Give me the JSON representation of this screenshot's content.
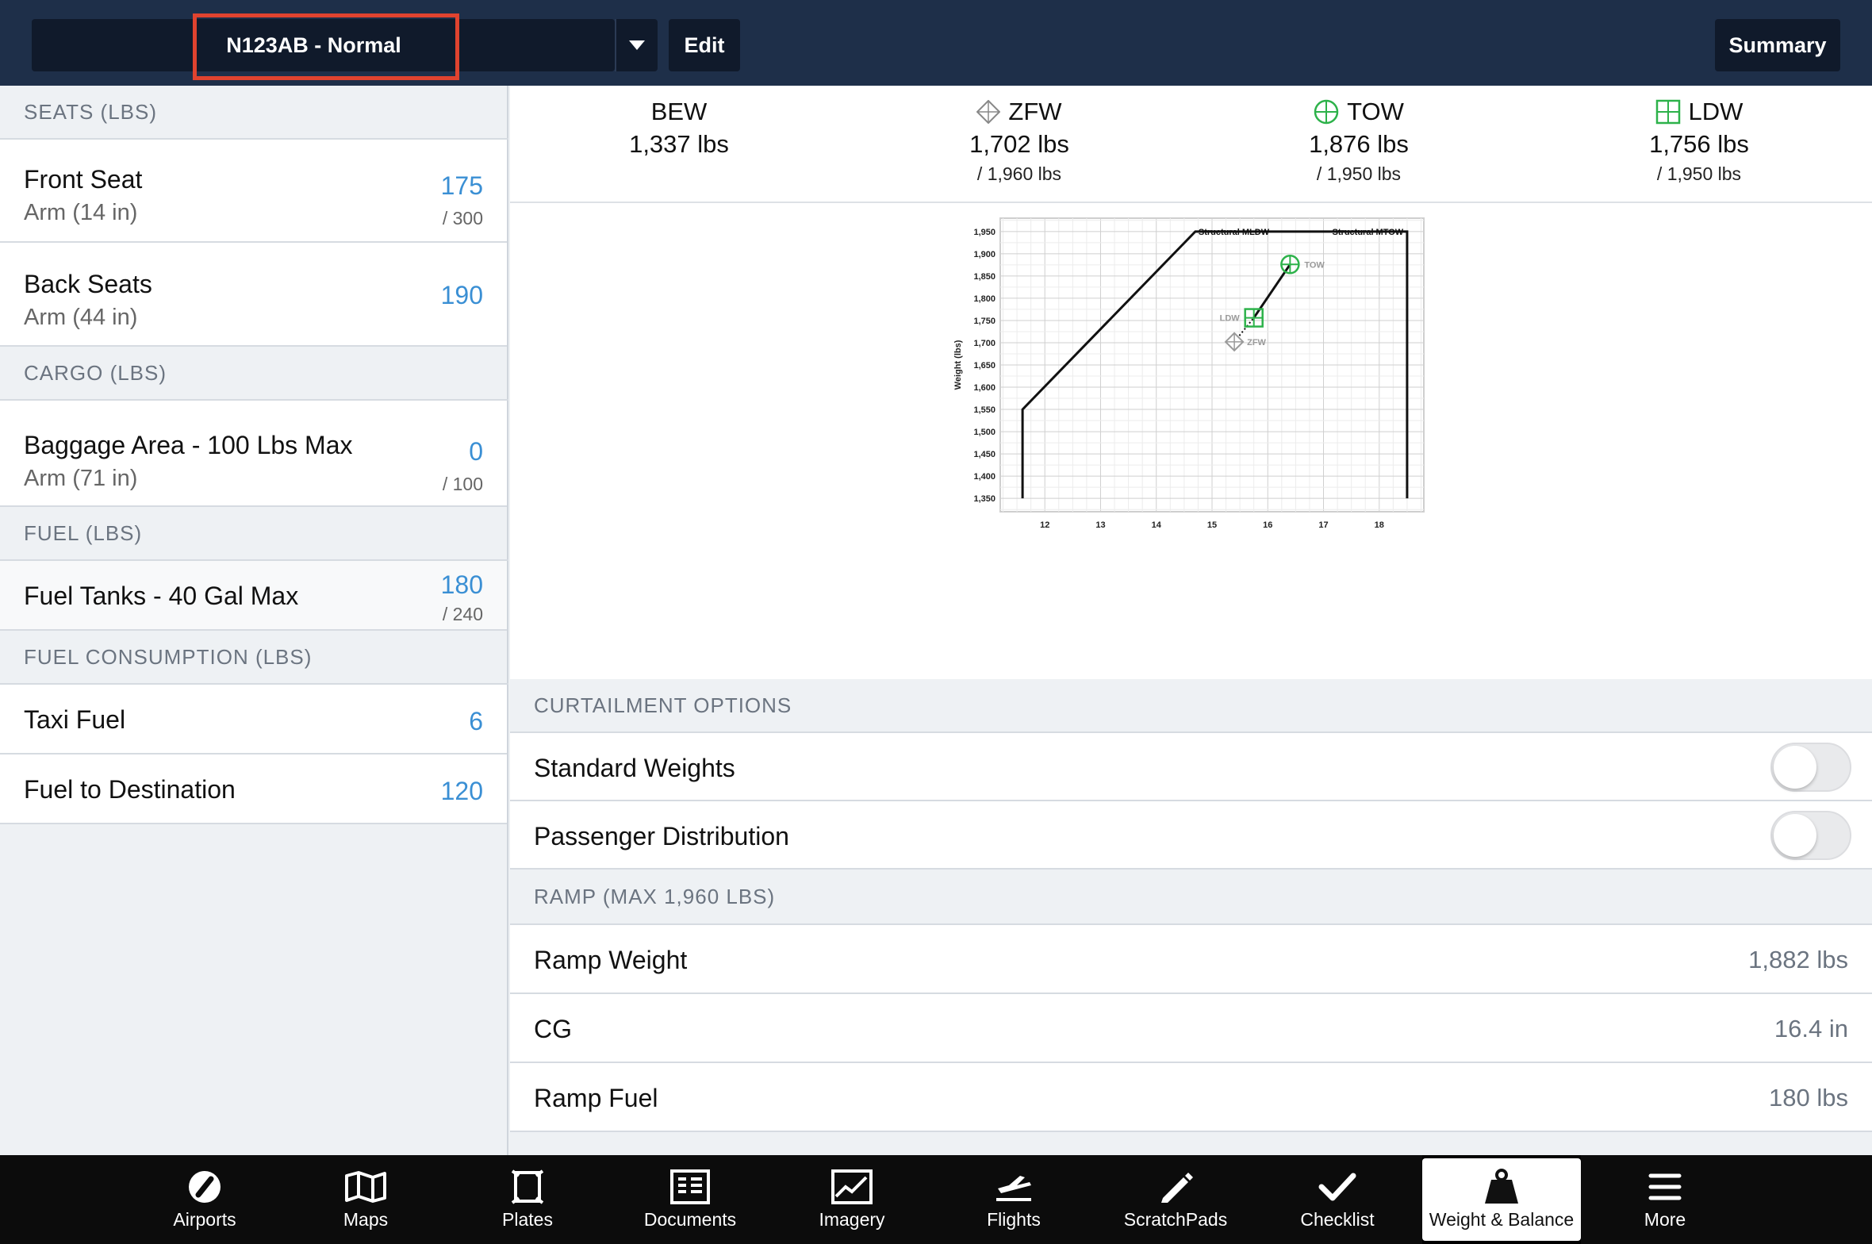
{
  "header": {
    "profile_label": "N123AB - Normal",
    "edit_label": "Edit",
    "summary_label": "Summary"
  },
  "left": {
    "sections": {
      "seats": "SEATS (LBS)",
      "cargo": "CARGO (LBS)",
      "fuel": "FUEL (LBS)",
      "consumption": "FUEL CONSUMPTION (LBS)"
    },
    "front_seat": {
      "title": "Front Seat",
      "arm": "Arm (14 in)",
      "value": "175",
      "max": "/ 300"
    },
    "back_seats": {
      "title": "Back Seats",
      "arm": "Arm (44 in)",
      "value": "190"
    },
    "baggage": {
      "title": "Baggage Area - 100 Lbs Max",
      "arm": "Arm (71 in)",
      "value": "0",
      "max": "/ 100"
    },
    "fuel_tanks": {
      "title": "Fuel Tanks - 40 Gal Max",
      "value": "180",
      "max": "/ 240"
    },
    "taxi_fuel": {
      "title": "Taxi Fuel",
      "value": "6"
    },
    "fuel_to_dest": {
      "title": "Fuel to Destination",
      "value": "120"
    }
  },
  "stats": {
    "bew": {
      "label": "BEW",
      "value": "1,337 lbs"
    },
    "zfw": {
      "label": "ZFW",
      "value": "1,702 lbs",
      "max": "/ 1,960 lbs"
    },
    "tow": {
      "label": "TOW",
      "value": "1,876 lbs",
      "max": "/ 1,950 lbs"
    },
    "ldw": {
      "label": "LDW",
      "value": "1,756 lbs",
      "max": "/ 1,950 lbs"
    }
  },
  "chart_data": {
    "type": "scatter",
    "title": "",
    "xlabel": "",
    "ylabel": "Weight (lbs)",
    "xlim": [
      11.2,
      18.8
    ],
    "ylim": [
      1320,
      1980
    ],
    "x_ticks": [
      12,
      13,
      14,
      15,
      16,
      17,
      18
    ],
    "y_ticks": [
      1350,
      1400,
      1450,
      1500,
      1550,
      1600,
      1650,
      1700,
      1750,
      1800,
      1850,
      1900,
      1950
    ],
    "envelope": [
      [
        11.6,
        1350
      ],
      [
        11.6,
        1550
      ],
      [
        14.7,
        1950
      ],
      [
        18.5,
        1950
      ],
      [
        18.5,
        1350
      ]
    ],
    "annotations": [
      "Structural MLDW",
      "Structural MTOW"
    ],
    "points": [
      {
        "name": "ZFW",
        "x": 15.4,
        "y": 1702,
        "symbol": "diamond",
        "color": "#9a9a9a"
      },
      {
        "name": "LDW",
        "x": 15.75,
        "y": 1756,
        "symbol": "square-cross",
        "color": "#2db24a"
      },
      {
        "name": "TOW",
        "x": 16.4,
        "y": 1876,
        "symbol": "circle-cross",
        "color": "#2db24a"
      }
    ],
    "grid": true
  },
  "curtailment": {
    "header": "CURTAILMENT OPTIONS",
    "standard_weights": "Standard Weights",
    "passenger_distribution": "Passenger Distribution"
  },
  "ramp": {
    "header": "RAMP (MAX 1,960 LBS)",
    "weight_label": "Ramp Weight",
    "weight_value": "1,882 lbs",
    "cg_label": "CG",
    "cg_value": "16.4 in",
    "fuel_label": "Ramp Fuel",
    "fuel_value": "180 lbs"
  },
  "tabs": [
    {
      "label": "Airports",
      "icon": "airports-icon"
    },
    {
      "label": "Maps",
      "icon": "maps-icon"
    },
    {
      "label": "Plates",
      "icon": "plates-icon"
    },
    {
      "label": "Documents",
      "icon": "documents-icon"
    },
    {
      "label": "Imagery",
      "icon": "imagery-icon"
    },
    {
      "label": "Flights",
      "icon": "flights-icon"
    },
    {
      "label": "ScratchPads",
      "icon": "scratchpads-icon"
    },
    {
      "label": "Checklist",
      "icon": "checklist-icon"
    },
    {
      "label": "Weight & Balance",
      "icon": "weight-balance-icon"
    },
    {
      "label": "More",
      "icon": "more-icon"
    }
  ],
  "active_tab": "Weight & Balance",
  "colors": {
    "header_bg": "#1e2f49",
    "accent_blue": "#3a8fd4",
    "highlight_red": "#e0432f",
    "green": "#2db24a"
  }
}
